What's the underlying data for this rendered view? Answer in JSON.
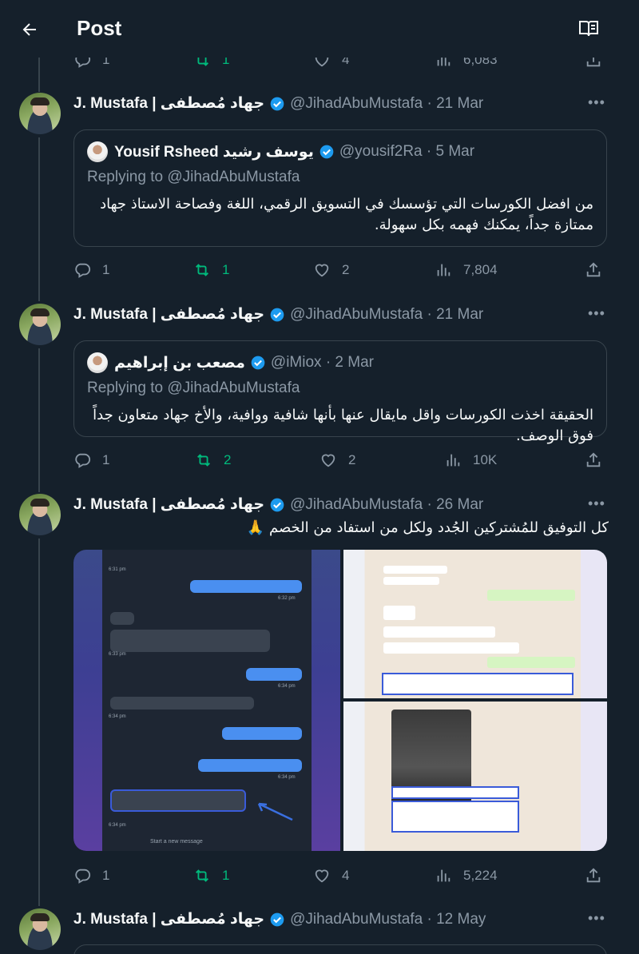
{
  "header": {
    "title": "Post"
  },
  "prev_actions": {
    "replies": "1",
    "retweets": "1",
    "likes": "4",
    "views": "6,083"
  },
  "posts": [
    {
      "author_name": "J. Mustafa | جهاد مُصطفى",
      "handle_date": "@JihadAbuMustafa · 21 Mar",
      "quote": {
        "author_name": "Yousif Rsheed يوسف رشيد",
        "handle_date": "@yousif2Ra · 5 Mar",
        "replying_to": "Replying to @JihadAbuMustafa",
        "text": "من افضل الكورسات التي تؤسسك في التسويق الرقمي، اللغة وفصاحة الاستاذ جهاد ممتازة جداً، يمكنك فهمه بكل سهولة."
      },
      "actions": {
        "replies": "1",
        "retweets": "1",
        "likes": "2",
        "views": "7,804"
      }
    },
    {
      "author_name": "J. Mustafa | جهاد مُصطفى",
      "handle_date": "@JihadAbuMustafa · 21 Mar",
      "quote": {
        "author_name": "مصعب بن إبراهيم",
        "handle_date": "@iMiox · 2 Mar",
        "replying_to": "Replying to @JihadAbuMustafa",
        "text": "الحقيقة اخذت الكورسات واقل مايقال عنها بأنها شافية ووافية، والأخ جهاد متعاون جداً فوق الوصف."
      },
      "actions": {
        "replies": "1",
        "retweets": "2",
        "likes": "2",
        "views": "10K"
      }
    },
    {
      "author_name": "J. Mustafa | جهاد مُصطفى",
      "handle_date": "@JihadAbuMustafa · 26 Mar",
      "text": "كل التوفيق للمُشتركين الجُدد ولكل من استفاد من الخصم 🙏",
      "media_timestamps": [
        "6:31 pm",
        "6:32 pm",
        "6:33 pm",
        "6:34 pm",
        "6:34 pm",
        "6:34 pm",
        "6:34 pm"
      ],
      "media_input_placeholder": "Start a new message",
      "actions": {
        "replies": "1",
        "retweets": "1",
        "likes": "4",
        "views": "5,224"
      }
    },
    {
      "author_name": "J. Mustafa | جهاد مُصطفى",
      "handle_date": "@JihadAbuMustafa · 12 May"
    }
  ],
  "colors": {
    "background": "#15202b",
    "accent": "#1d9bf0",
    "retweet": "#00ba7c",
    "muted": "#8b98a5"
  }
}
